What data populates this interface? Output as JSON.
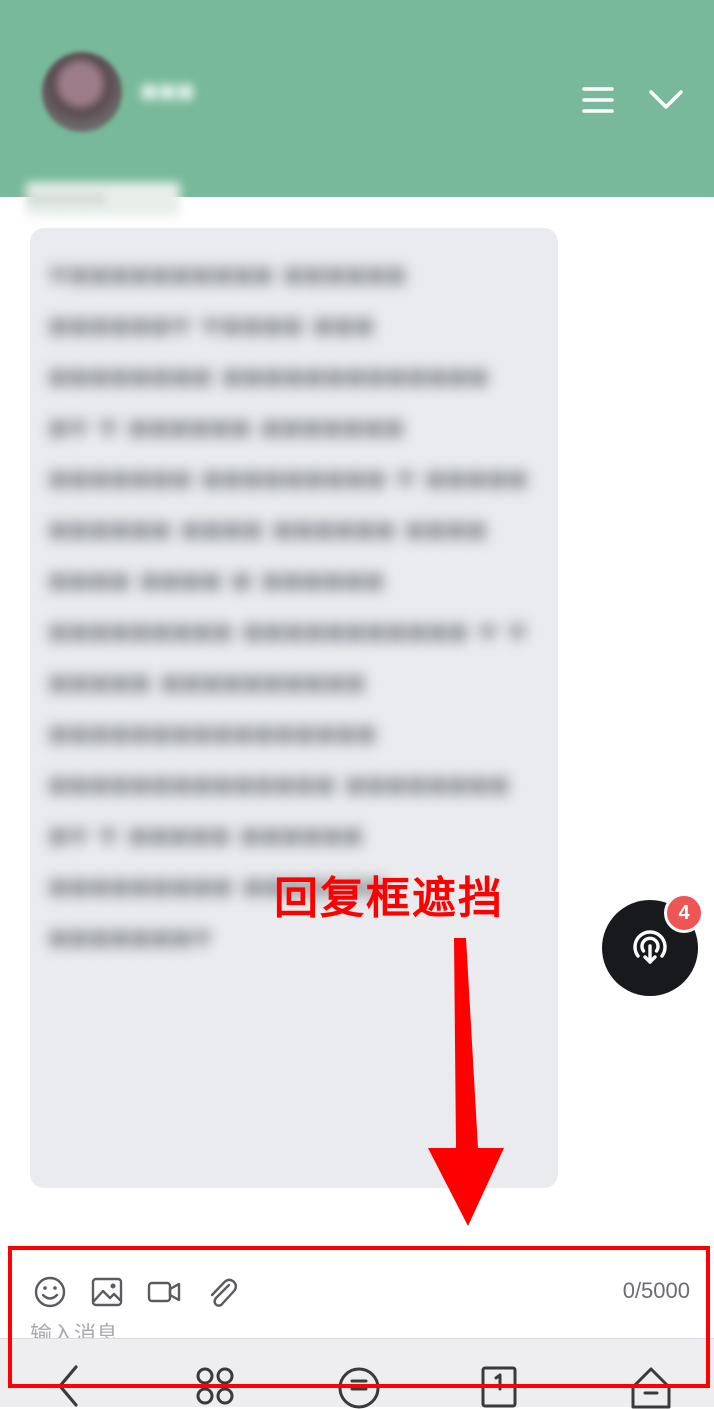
{
  "header": {
    "bg_color": "#77b99a",
    "user_name": "■■■",
    "subtitle": "■■■■■■",
    "icons": [
      "menu-icon",
      "chevron-down-icon"
    ]
  },
  "message": {
    "bubble_color": "#e9ebee",
    "text": "♥■■■■■■■■■■ ■■■■■■ ■■■■■■♥ ♥■■■■ ■■■ ■■■■■■■■ ■■■■■■■■■■■■■ ■♥ ♥ ■■■■■■ ■■■■■■■ ■■■■■■■ ■■■■■■■■■ ♥ ■■■■■ ■■■■■■ ■■■■ ■■■■■■ ■■■■ ■■■■ ■■■■ ■ ■■■■■■ ■■■■■■■■■ ■■■■■■■■■■■ ♥ ♥ ■■■■■ ■■■■■■■■■■ ■■■■■■■■■■■■■■■■ ■■■■■■■■■■■■■■ ■■■■■■■■ ■♥ ♥ ■■■■■ ■■■■■■ ■■■■■■■■■ ■■■■■■■ ■■■■■■■♥"
  },
  "fab": {
    "icon": "podcast-download-icon",
    "badge_count": "4",
    "badge_color": "#ee5555"
  },
  "annotation": {
    "label": "回复框遮挡",
    "color": "#ff0000"
  },
  "reply_box": {
    "toolbar_icons": [
      "emoji-icon",
      "image-icon",
      "video-icon",
      "attachment-icon"
    ],
    "char_counter": "0/5000",
    "input_placeholder": "输入消息"
  },
  "nav_bar": {
    "icons": [
      "back-icon",
      "apps-icon",
      "minus-circle-icon",
      "one-square-icon",
      "home-icon"
    ]
  }
}
